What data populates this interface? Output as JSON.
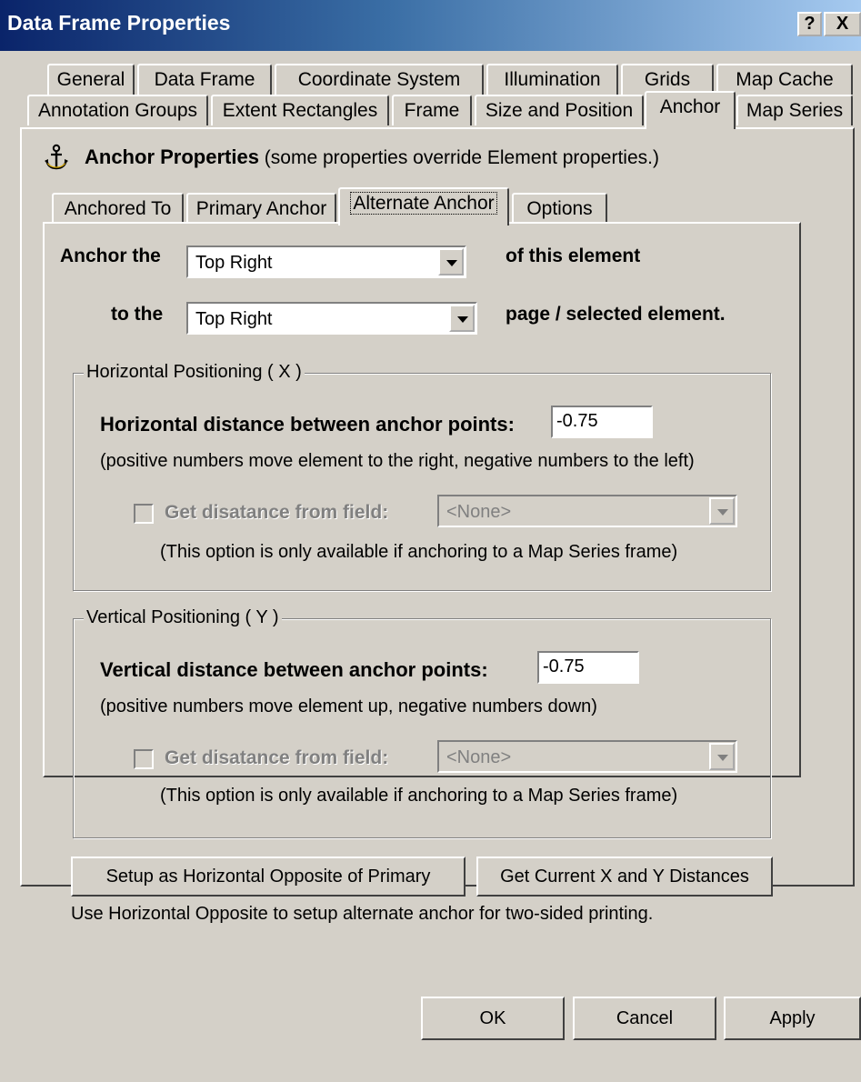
{
  "window": {
    "title": "Data Frame Properties",
    "help_label": "?",
    "close_label": "X"
  },
  "outer_tabs": {
    "row1": [
      "General",
      "Data Frame",
      "Coordinate System",
      "Illumination",
      "Grids",
      "Map Cache"
    ],
    "row2": [
      "Annotation Groups",
      "Extent Rectangles",
      "Frame",
      "Size and Position",
      "Anchor",
      "Map Series"
    ],
    "selected": "Anchor"
  },
  "anchor_panel": {
    "icon": "anchor-icon",
    "title_bold": "Anchor Properties",
    "title_note": "(some properties override Element properties.)"
  },
  "inner_tabs": {
    "items": [
      "Anchored To",
      "Primary Anchor",
      "Alternate Anchor",
      "Options"
    ],
    "selected": "Alternate Anchor"
  },
  "anchor_the": {
    "label": "Anchor the",
    "value": "Top Right",
    "suffix": "of this element"
  },
  "to_the": {
    "label": "to the",
    "value": "Top Right",
    "suffix": "page / selected element."
  },
  "horizontal": {
    "legend": "Horizontal Positioning ( X )",
    "distance_label": "Horizontal distance between anchor points:",
    "distance_value": "-0.75",
    "hint": "(positive numbers move element to the right, negative numbers to the left)",
    "field_label": "Get disatance from field:",
    "field_value": "<None>",
    "field_checked": false,
    "field_note": "(This option is only available if anchoring to a Map Series frame)"
  },
  "vertical": {
    "legend": "Vertical Positioning ( Y )",
    "distance_label": "Vertical distance between anchor points:",
    "distance_value": "-0.75",
    "hint": "(positive numbers move element up, negative numbers down)",
    "field_label": "Get disatance from field:",
    "field_value": "<None>",
    "field_checked": false,
    "field_note": "(This option is only available if anchoring to a Map Series frame)"
  },
  "actions": {
    "opposite_label": "Setup as Horizontal Opposite of Primary",
    "current_label": "Get Current X and Y Distances",
    "footer_note": "Use Horizontal Opposite to setup alternate anchor for two-sided printing."
  },
  "dialog_buttons": {
    "ok": "OK",
    "cancel": "Cancel",
    "apply": "Apply"
  },
  "colors": {
    "face": "#d4d0c8",
    "title_start": "#0a246a",
    "title_end": "#a6caf0",
    "disabled_text": "#808080"
  }
}
